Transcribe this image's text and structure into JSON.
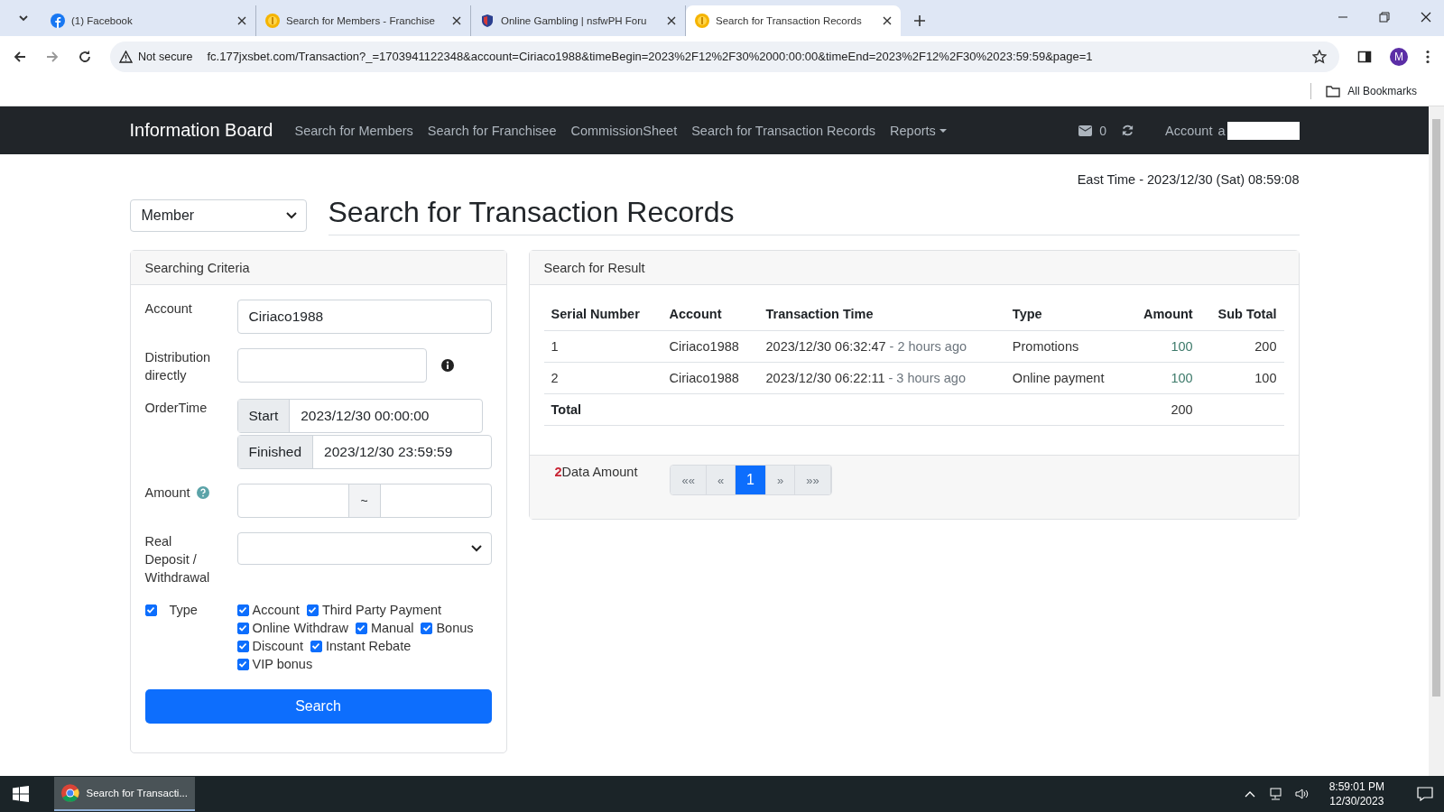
{
  "browser": {
    "tabs": [
      {
        "kind": "facebook",
        "title": "(1) Facebook",
        "selected": false
      },
      {
        "kind": "coin",
        "title": "Search for Members - Franchise",
        "selected": false
      },
      {
        "kind": "shield",
        "title": "Online Gambling | nsfwPH Foru",
        "selected": false
      },
      {
        "kind": "coin",
        "title": "Search for Transaction Records",
        "selected": true
      }
    ],
    "security": "Not secure",
    "url": "fc.177jxsbet.com/Transaction?_=1703941122348&account=Ciriaco1988&timeBegin=2023%2F12%2F30%2000:00:00&timeEnd=2023%2F12%2F30%2023:59:59&page=1",
    "profile": "M",
    "bookmarks": "All Bookmarks"
  },
  "navbar": {
    "brand": "Information Board",
    "links": [
      {
        "label": "Search for Members",
        "dropdown": false
      },
      {
        "label": "Search for Franchisee",
        "dropdown": false
      },
      {
        "label": "CommissionSheet",
        "dropdown": false
      },
      {
        "label": "Search for Transaction Records",
        "dropdown": false
      },
      {
        "label": "Reports",
        "dropdown": true
      }
    ],
    "message_count": "0",
    "account_label": "Account",
    "account_value": "a"
  },
  "east_time": "East Time - 2023/12/30 (Sat) 08:59:08",
  "member_select": "Member",
  "page_title": "Search for Transaction Records",
  "criteria": {
    "title": "Searching Criteria",
    "account_label": "Account",
    "account_value": "Ciriaco1988",
    "distribution_label": "Distribution directly",
    "order_time_label": "OrderTime",
    "start_label": "Start",
    "start_value": "2023/12/30 00:00:00",
    "finished_label": "Finished",
    "finished_value": "2023/12/30 23:59:59",
    "amount_label": "Amount",
    "range_sep": "~",
    "deposit_label": "Real Deposit / Withdrawal",
    "type_label": "Type",
    "type_checked": true,
    "types": [
      {
        "label": "Account",
        "checked": true
      },
      {
        "label": "Third Party Payment",
        "checked": true
      },
      {
        "label": "Online Withdraw",
        "checked": true
      },
      {
        "label": "Manual",
        "checked": true
      },
      {
        "label": "Bonus",
        "checked": true
      },
      {
        "label": "Discount",
        "checked": true
      },
      {
        "label": "Instant Rebate",
        "checked": true
      },
      {
        "label": "VIP bonus",
        "checked": true
      }
    ],
    "search_button": "Search"
  },
  "result": {
    "title": "Search for Result",
    "columns": [
      "Serial Number",
      "Account",
      "Transaction Time",
      "Type",
      "Amount",
      "Sub Total"
    ],
    "rows": [
      {
        "serial": "1",
        "account": "Ciriaco1988",
        "time": "2023/12/30 06:32:47",
        "ago": "- 2 hours ago",
        "type": "Promotions",
        "amount": "100",
        "subtotal": "200"
      },
      {
        "serial": "2",
        "account": "Ciriaco1988",
        "time": "2023/12/30 06:22:11",
        "ago": "- 3 hours ago",
        "type": "Online payment",
        "amount": "100",
        "subtotal": "100"
      }
    ],
    "total_label": "Total",
    "total_amount": "200",
    "count": "2",
    "count_label": "Data Amount",
    "pager": [
      {
        "label": "««",
        "selected": false
      },
      {
        "label": "«",
        "selected": false
      },
      {
        "label": "1",
        "selected": true
      },
      {
        "label": "»",
        "selected": false
      },
      {
        "label": "»»",
        "selected": false
      }
    ]
  },
  "taskbar": {
    "app": "Search for Transacti...",
    "time": "8:59:01 PM",
    "date": "12/30/2023"
  }
}
